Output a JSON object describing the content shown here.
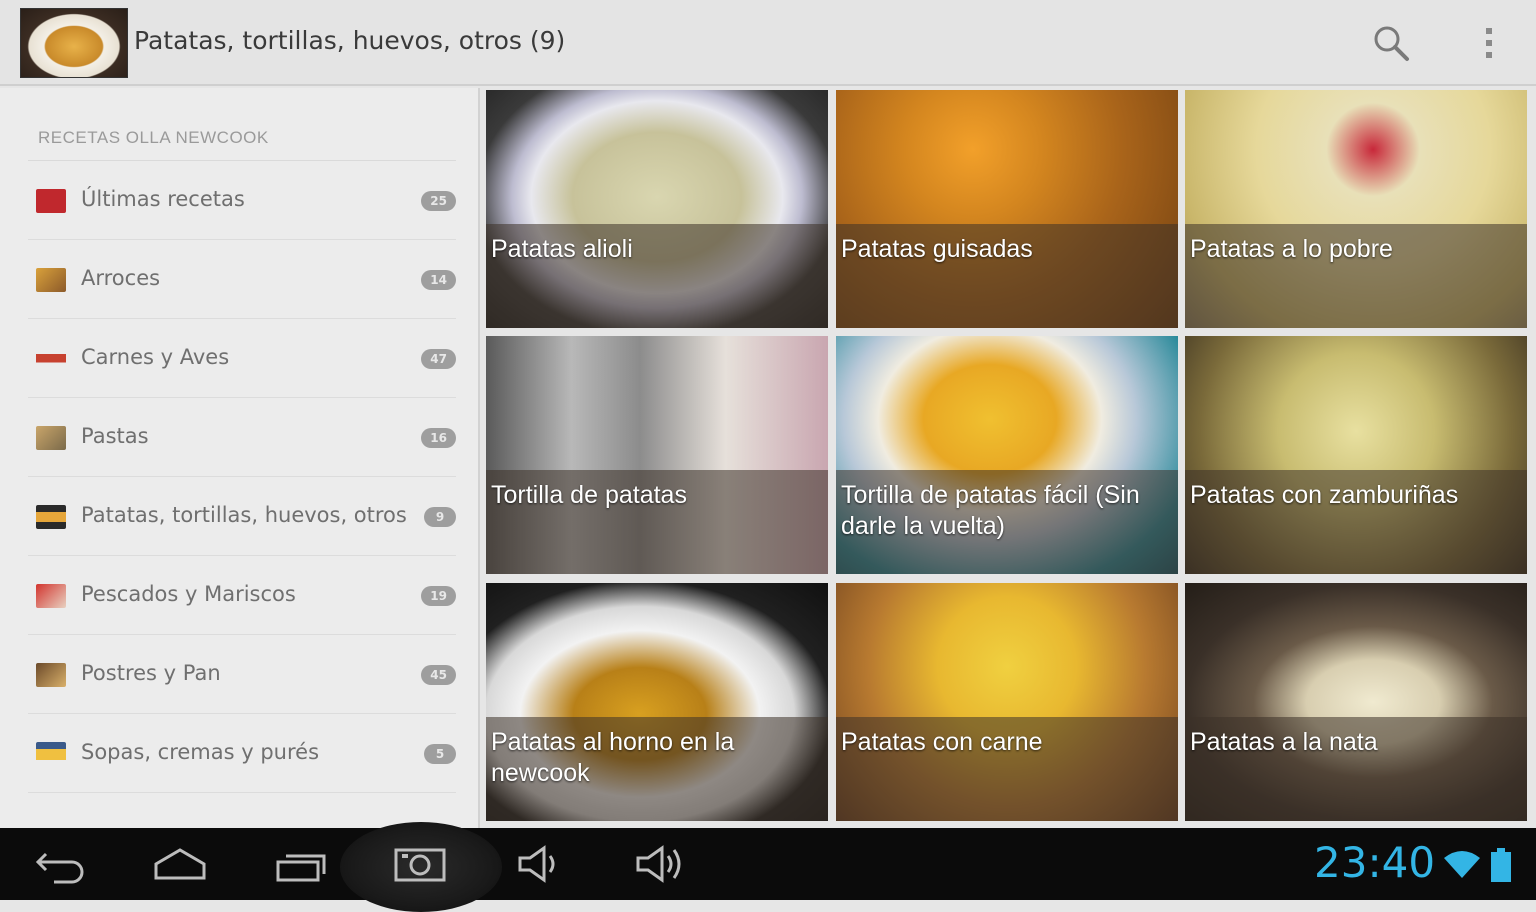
{
  "actionbar": {
    "title": "Patatas, tortillas, huevos, otros (9)",
    "icons": {
      "app": "tortilla-thumbnail-icon",
      "search": "search-icon",
      "overflow": "overflow-menu-icon"
    }
  },
  "drawer": {
    "header": "RECETAS OLLA NEWCOOK",
    "items": [
      {
        "label": "Últimas recetas",
        "count": "25",
        "icon": "recent-recipes-icon"
      },
      {
        "label": "Arroces",
        "count": "14",
        "icon": "rice-icon"
      },
      {
        "label": "Carnes y Aves",
        "count": "47",
        "icon": "meat-icon"
      },
      {
        "label": "Pastas",
        "count": "16",
        "icon": "pasta-icon"
      },
      {
        "label": "Patatas, tortillas, huevos, otros",
        "count": "9",
        "icon": "potato-icon"
      },
      {
        "label": "Pescados y Mariscos",
        "count": "19",
        "icon": "fish-icon"
      },
      {
        "label": "Postres y Pan",
        "count": "45",
        "icon": "dessert-icon"
      },
      {
        "label": "Sopas, cremas y purés",
        "count": "5",
        "icon": "soup-icon"
      }
    ]
  },
  "recipes": [
    {
      "title": "Patatas alioli"
    },
    {
      "title": "Patatas guisadas"
    },
    {
      "title": "Patatas a lo pobre"
    },
    {
      "title": "Tortilla de patatas"
    },
    {
      "title": "Tortilla de patatas fácil (Sin darle la vuelta)"
    },
    {
      "title": "Patatas con zamburiñas"
    },
    {
      "title": "Patatas al horno en la newcook"
    },
    {
      "title": "Patatas con carne"
    },
    {
      "title": "Patatas a la nata"
    }
  ],
  "statusbar": {
    "time": "23:40",
    "accent": "#33b5e5"
  }
}
